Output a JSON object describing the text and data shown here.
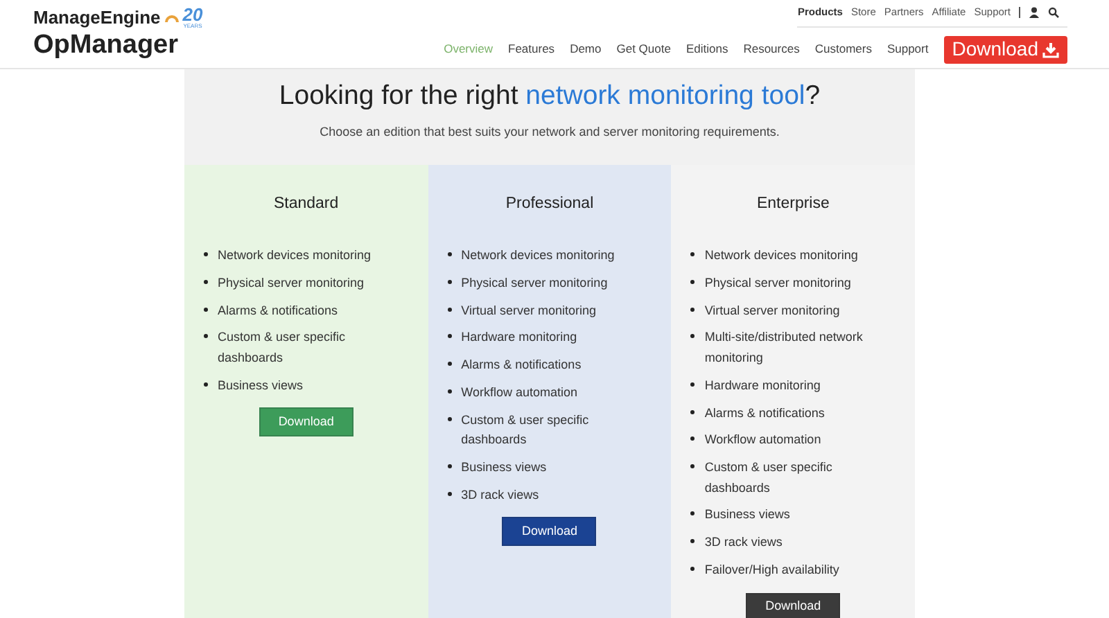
{
  "brand": {
    "company": "ManageEngine",
    "anniversary": "20",
    "anniversary_caption": "YEARS",
    "product": "OpManager"
  },
  "top_links": [
    {
      "label": "Products",
      "bold": true
    },
    {
      "label": "Store",
      "bold": false
    },
    {
      "label": "Partners",
      "bold": false
    },
    {
      "label": "Affiliate",
      "bold": false
    },
    {
      "label": "Support",
      "bold": false
    }
  ],
  "nav": [
    {
      "label": "Overview",
      "selected": true
    },
    {
      "label": "Features",
      "selected": false
    },
    {
      "label": "Demo",
      "selected": false
    },
    {
      "label": "Get Quote",
      "selected": false
    },
    {
      "label": "Editions",
      "selected": false
    },
    {
      "label": "Resources",
      "selected": false
    },
    {
      "label": "Customers",
      "selected": false
    },
    {
      "label": "Support",
      "selected": false
    }
  ],
  "download_button": "Download",
  "heading": {
    "before": "Looking for the right ",
    "link": "network monitoring tool",
    "after": "?"
  },
  "subtitle": "Choose an edition that best suits your network and server monitoring requirements.",
  "editions": [
    {
      "name": "Standard",
      "color": "#e8f5e3",
      "kind": "standard",
      "features": [
        "Network devices monitoring",
        "Physical server monitoring",
        "Alarms & notifications",
        "Custom & user specific dashboards",
        "Business views"
      ],
      "button": "Download"
    },
    {
      "name": "Professional",
      "color": "#e0e7f3",
      "kind": "professional",
      "features": [
        "Network devices monitoring",
        "Physical server monitoring",
        "Virtual server monitoring",
        "Hardware monitoring",
        "Alarms & notifications",
        "Workflow automation",
        "Custom & user specific dashboards",
        "Business views",
        "3D rack views"
      ],
      "button": "Download"
    },
    {
      "name": "Enterprise",
      "color": "#f3f3f3",
      "kind": "enterprise",
      "features": [
        "Network devices monitoring",
        "Physical server monitoring",
        "Virtual server monitoring",
        "Multi-site/distributed network monitoring",
        "Hardware monitoring",
        "Alarms & notifications",
        "Workflow automation",
        "Custom & user specific dashboards",
        "Business views",
        "3D rack views",
        "Failover/High availability"
      ],
      "button": "Download"
    }
  ]
}
